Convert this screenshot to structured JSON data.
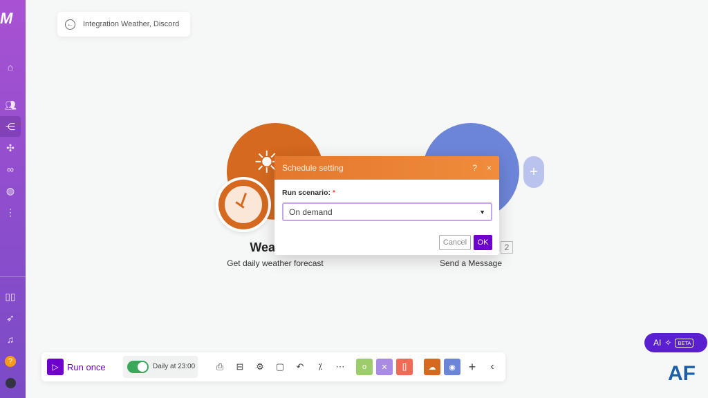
{
  "sidebar": {
    "logo": "M",
    "items": [
      "home",
      "team",
      "scenarios",
      "apps",
      "connections",
      "webhooks",
      "more",
      "docs",
      "whats-new",
      "notifications",
      "help",
      "profile"
    ]
  },
  "header": {
    "title": "Integration Weather, Discord"
  },
  "modules": [
    {
      "title": "Wea",
      "subtitle": "Get daily weather forecast",
      "color": "#d4691f"
    },
    {
      "subtitle": "Send a Message",
      "badge": "2",
      "color": "#6d85d9"
    }
  ],
  "dialog": {
    "title": "Schedule setting",
    "help": "?",
    "close": "×",
    "field_label": "Run scenario:",
    "required": "*",
    "selected": "On demand",
    "cancel": "Cancel",
    "ok": "OK"
  },
  "toolbar": {
    "run_once": "Run once",
    "schedule": "Daily at 23:00",
    "schedule_on": true
  },
  "ai": {
    "label": "AI",
    "badge": "BETA"
  },
  "watermark": "AF",
  "colors": {
    "accent": "#6d00cc",
    "orange": "#e3782c",
    "discord": "#6d85d9"
  }
}
